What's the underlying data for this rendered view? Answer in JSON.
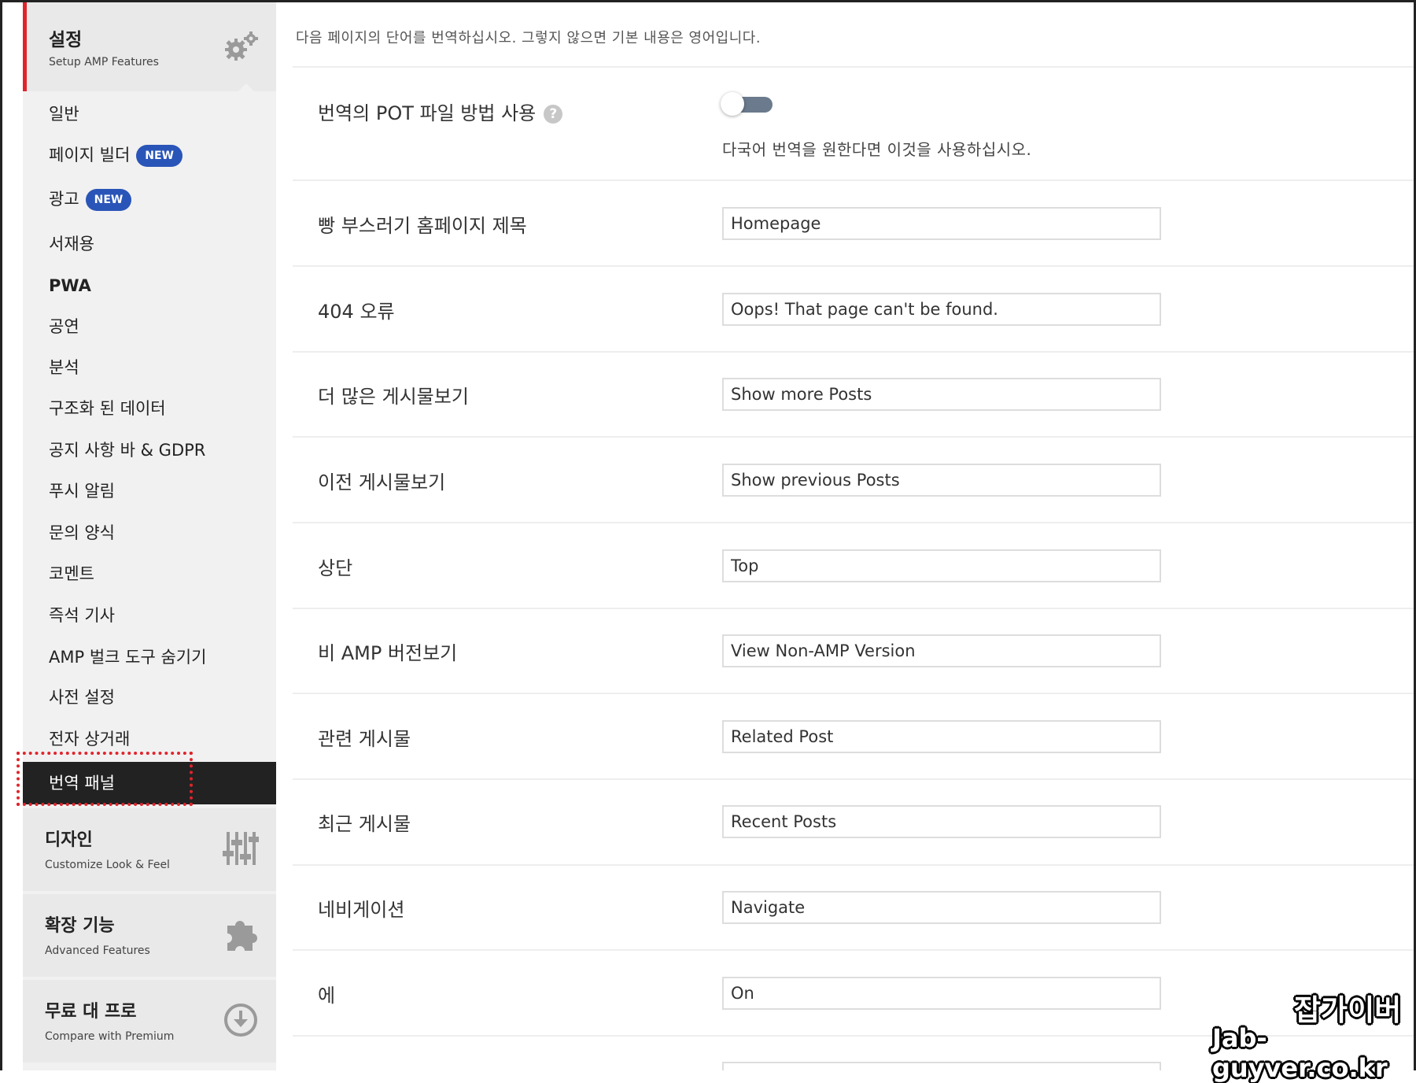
{
  "sidebar": {
    "header": {
      "title": "설정",
      "subtitle": "Setup AMP Features",
      "icon": "gears-icon"
    },
    "items": [
      {
        "label": "일반",
        "bold": false
      },
      {
        "label": "페이지 빌더",
        "badge": "NEW",
        "bold": false
      },
      {
        "label": "광고",
        "badge": "NEW",
        "bold": false
      },
      {
        "label": "서재용",
        "bold": false
      },
      {
        "label": "PWA",
        "bold": true
      },
      {
        "label": "공연",
        "bold": false
      },
      {
        "label": "분석",
        "bold": false
      },
      {
        "label": "구조화 된 데이터",
        "bold": false
      },
      {
        "label": "공지 사항 바 & GDPR",
        "bold": false
      },
      {
        "label": "푸시 알림",
        "bold": false
      },
      {
        "label": "문의 양식",
        "bold": false
      },
      {
        "label": "코멘트",
        "bold": false
      },
      {
        "label": "즉석 기사",
        "bold": false
      },
      {
        "label": "AMP 벌크 도구 숨기기",
        "bold": false
      },
      {
        "label": "사전 설정",
        "bold": false
      },
      {
        "label": "전자 상거래",
        "bold": false
      }
    ],
    "active_item": "번역 패널",
    "sections": [
      {
        "title": "디자인",
        "subtitle": "Customize Look & Feel",
        "icon": "sliders-icon"
      },
      {
        "title": "확장 기능",
        "subtitle": "Advanced Features",
        "icon": "puzzle-icon"
      },
      {
        "title": "무료 대 프로",
        "subtitle": "Compare with Premium",
        "icon": "download-circle-icon"
      }
    ]
  },
  "main": {
    "description": "다음 페이지의 단어를 번역하십시오. 그렇지 않으면 기본 내용은 영어입니다.",
    "pot_toggle": {
      "label": "번역의 POT 파일 방법 사용",
      "help_icon": "question-icon",
      "enabled": false,
      "help_text": "다국어 번역을 원한다면 이것을 사용하십시오."
    },
    "fields": [
      {
        "label": "빵 부스러기 홈페이지 제목",
        "value": "Homepage"
      },
      {
        "label": "404 오류",
        "value": "Oops! That page can't be found."
      },
      {
        "label": "더 많은 게시물보기",
        "value": "Show more Posts"
      },
      {
        "label": "이전 게시물보기",
        "value": "Show previous Posts"
      },
      {
        "label": "상단",
        "value": "Top"
      },
      {
        "label": "비 AMP 버전보기",
        "value": "View Non-AMP Version"
      },
      {
        "label": "관련 게시물",
        "value": "Related Post"
      },
      {
        "label": "최근 게시물",
        "value": "Recent Posts"
      },
      {
        "label": "네비게이션",
        "value": "Navigate"
      },
      {
        "label": "에",
        "value": "On"
      }
    ]
  },
  "watermark": {
    "line1": "잡가이버",
    "line2": "Jab-guyver.co.kr"
  },
  "colors": {
    "accent": "#e0242c",
    "badge": "#2a55b8",
    "active_bg": "#222222",
    "toggle_track": "#6b7a8d"
  }
}
